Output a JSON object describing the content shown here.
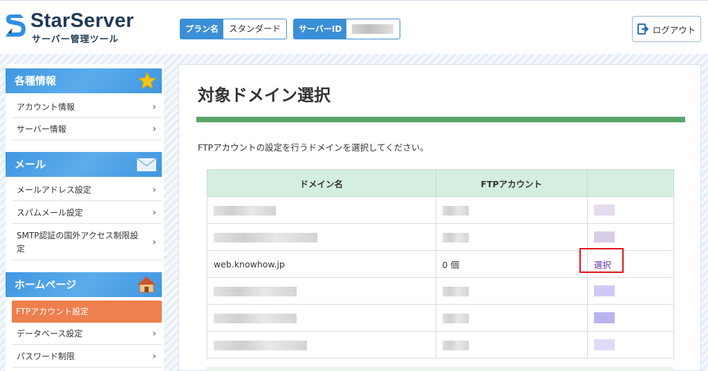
{
  "header": {
    "logo_title": "StarServer",
    "logo_subtitle": "サーバー管理ツール",
    "plan_label": "プラン名",
    "plan_value": "スタンダード",
    "server_id_label": "サーバーID",
    "logout_label": "ログアウト"
  },
  "sidebar": {
    "sections": [
      {
        "title": "各種情報",
        "icon": "star-icon",
        "items": [
          "アカウント情報",
          "サーバー情報"
        ]
      },
      {
        "title": "メール",
        "icon": "mail-icon",
        "items": [
          "メールアドレス設定",
          "スパムメール設定",
          "SMTP認証の国外アクセス制限設定"
        ]
      },
      {
        "title": "ホームページ",
        "icon": "house-icon",
        "items": [
          "FTPアカウント設定",
          "データベース設定",
          "パスワード制限"
        ]
      }
    ],
    "active_item": "FTPアカウント設定"
  },
  "main": {
    "title": "対象ドメイン選択",
    "description": "FTPアカウントの設定を行うドメインを選択してください。",
    "table": {
      "headers": [
        "ドメイン名",
        "FTPアカウント",
        ""
      ],
      "rows": [
        {
          "domain": "",
          "count": "",
          "action": ""
        },
        {
          "domain": "",
          "count": "",
          "action": ""
        },
        {
          "domain": "web.knowhow.jp",
          "count": "0 個",
          "action": "選択"
        },
        {
          "domain": "",
          "count": "",
          "action": ""
        },
        {
          "domain": "",
          "count": "",
          "action": ""
        },
        {
          "domain": "",
          "count": "",
          "action": ""
        }
      ]
    }
  },
  "colors": {
    "accent_blue": "#3b8fd6",
    "active_orange": "#ee7f4e",
    "green_bar": "#5aa469",
    "table_header": "#d4eee0",
    "highlight_red": "#e0121b",
    "link_purple": "#6a2aa8"
  }
}
